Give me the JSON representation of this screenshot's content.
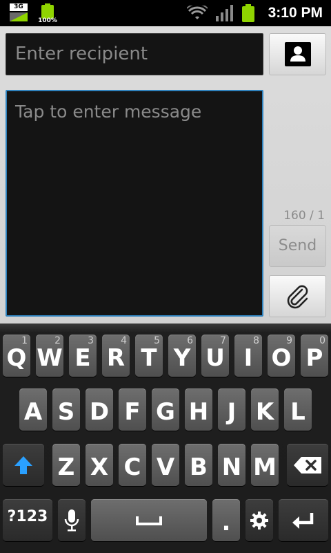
{
  "status_bar": {
    "network_type": "3G",
    "battery_percent_label": "100%",
    "time": "3:10 PM",
    "battery_color": "#8fd400"
  },
  "compose": {
    "recipient_placeholder": "Enter recipient",
    "message_placeholder": "Tap to enter message",
    "char_counter": "160 / 1",
    "send_label": "Send",
    "accent_color": "#2f82bd",
    "contact_icon": "contact-icon",
    "attach_icon": "paperclip-icon"
  },
  "keyboard": {
    "row1": [
      {
        "label": "Q",
        "sub": "1"
      },
      {
        "label": "W",
        "sub": "2"
      },
      {
        "label": "E",
        "sub": "3"
      },
      {
        "label": "R",
        "sub": "4"
      },
      {
        "label": "T",
        "sub": "5"
      },
      {
        "label": "Y",
        "sub": "6"
      },
      {
        "label": "U",
        "sub": "7"
      },
      {
        "label": "I",
        "sub": "8"
      },
      {
        "label": "O",
        "sub": "9"
      },
      {
        "label": "P",
        "sub": "0"
      }
    ],
    "row2": [
      "A",
      "S",
      "D",
      "F",
      "G",
      "H",
      "J",
      "K",
      "L"
    ],
    "row3": [
      "Z",
      "X",
      "C",
      "V",
      "B",
      "N",
      "M"
    ],
    "symbols_label": "?123",
    "period_label": ".",
    "shift_color": "#2aa0ff",
    "icons": [
      "shift-icon",
      "backspace-icon",
      "microphone-icon",
      "space-icon",
      "settings-icon",
      "enter-icon"
    ]
  }
}
